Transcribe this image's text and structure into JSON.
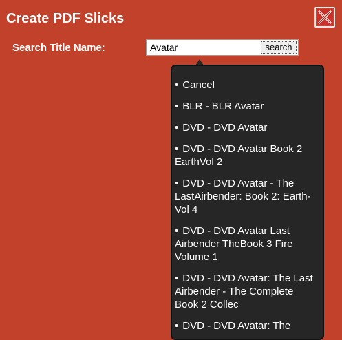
{
  "dialog": {
    "title": "Create PDF Slicks",
    "close_icon": "close-x-icon"
  },
  "search": {
    "label": "Search Title Name:",
    "value": "Avatar",
    "button_label": "search"
  },
  "results": {
    "bullet": "•",
    "items": [
      "Cancel",
      "BLR - BLR Avatar",
      "DVD - DVD Avatar",
      "DVD - DVD Avatar Book 2 EarthVol 2",
      "DVD - DVD Avatar - The LastAirbender: Book 2: Earth-Vol 4",
      "DVD - DVD Avatar Last Airbender TheBook 3 Fire Volume 1",
      "DVD - DVD Avatar: The Last Airbender - The Complete Book 2 Collec",
      "DVD - DVD Avatar: The"
    ]
  }
}
